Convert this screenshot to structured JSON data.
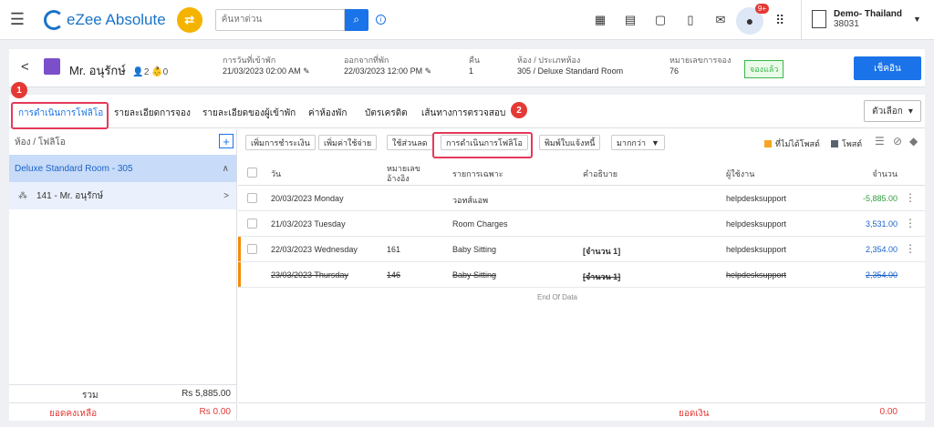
{
  "app": {
    "name": "eZee Absolute"
  },
  "search": {
    "placeholder": "ค้นหาด่วน"
  },
  "property": {
    "name": "Demo- Thailand",
    "code": "38031"
  },
  "notifications": {
    "badge": "9+"
  },
  "reservation": {
    "guest_name": "Mr. อนุรักษ์",
    "adults": "2",
    "children": "0",
    "arrival_label": "การวันที่เข้าพัก",
    "arrival_value": "21/03/2023 02:00 AM",
    "departure_label": "ออกจากที่พัก",
    "departure_value": "22/03/2023 12:00 PM",
    "nights_label": "คืน",
    "nights_value": "1",
    "room_label": "ห้อง / ประเภทห้อง",
    "room_value": "305 / Deluxe Standard Room",
    "resno_label": "หมายเลขการจอง",
    "resno_value": "76",
    "status": "จองแล้ว",
    "checkin_button": "เช็คอิน"
  },
  "tabs": [
    {
      "label": "การดำเนินการโฟลิโอ"
    },
    {
      "label": "รายละเอียดการจอง"
    },
    {
      "label": "รายละเอียดของผู้เข้าพัก"
    },
    {
      "label": "ค่าห้องพัก"
    },
    {
      "label": "บัตรเครดิต"
    },
    {
      "label": "เส้นทางการตรวจสอบ"
    }
  ],
  "options_button": "ตัวเลือก",
  "steps": [
    "1",
    "2"
  ],
  "left": {
    "header": "ห้อง / โฟลิโอ",
    "room": "Deluxe Standard Room - 305",
    "folio": "141 - Mr. อนุรักษ์",
    "total_label": "รวม",
    "total_value": "Rs 5,885.00",
    "balance_label": "ยอดคงเหลือ",
    "balance_value": "Rs 0.00"
  },
  "toolbar": {
    "add_payment": "เพิ่มการชำระเงิน",
    "add_charge": "เพิ่มค่าใช้จ่าย",
    "apply_discount": "ใช้ส่วนลด",
    "folio_ops": "การดำเนินการโฟลิโอ",
    "print_invoice": "พิมพ์ใบแจ้งหนี้",
    "more": "มากกว่า",
    "legend_unposted": "ที่ไม่ได้โพสต์",
    "legend_posted": "โพสต์"
  },
  "colors": {
    "unposted": "#f5a623",
    "posted": "#5a6270",
    "accent": "#1a73e8"
  },
  "table": {
    "headers": {
      "date": "วัน",
      "ref1": "หมายเลข",
      "ref2": "อ้างอิง",
      "particulars": "รายการเฉพาะ",
      "description": "คำอธิบาย",
      "user": "ผู้ใช้งาน",
      "amount": "จำนวน"
    },
    "rows": [
      {
        "date": "20/03/2023 Monday",
        "ref": "",
        "particulars": "วอทส์แอพ",
        "description": "",
        "user": "helpdesksupport",
        "amount": "-5,885.00"
      },
      {
        "date": "21/03/2023 Tuesday",
        "ref": "",
        "particulars": "Room Charges",
        "description": "",
        "user": "helpdesksupport",
        "amount": "3,531.00"
      },
      {
        "date": "22/03/2023 Wednesday",
        "ref": "161",
        "particulars": "Baby Sitting",
        "description": "[จำนวน 1]",
        "user": "helpdesksupport",
        "amount": "2,354.00"
      },
      {
        "date": "23/03/2023 Thursday",
        "ref": "146",
        "particulars": "Baby Sitting",
        "description": "[จำนวน 1]",
        "user": "helpdesksupport",
        "amount": "2,354.00"
      }
    ],
    "end_text": "End Of Data"
  },
  "footer": {
    "balance_label": "ยอดเงิน",
    "balance_value": "0.00"
  }
}
